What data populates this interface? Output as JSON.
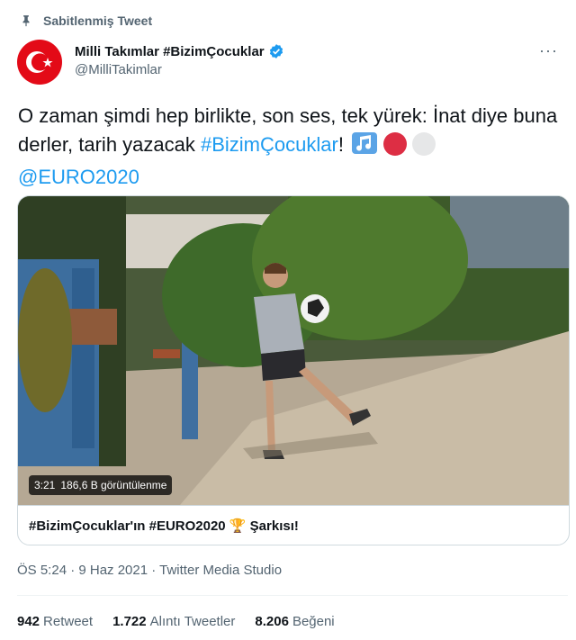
{
  "pinned_label": "Sabitlenmiş Tweet",
  "author": {
    "name": "Milli Takımlar #BizimÇocuklar",
    "handle": "@MilliTakimlar"
  },
  "tweet": {
    "text_part1": "O zaman şimdi hep birlikte, son ses, tek yürek: İnat diye buna derler, tarih yazacak ",
    "hashtag": "#BizimÇocuklar",
    "exclamation": "!",
    "mention": "@EURO2020"
  },
  "video": {
    "duration": "3:21",
    "views": "186,6 B görüntülenme",
    "card_title": "#BizimÇocuklar'ın #EURO2020 🏆 Şarkısı!"
  },
  "meta": "ÖS 5:24 · 9 Haz 2021 · Twitter Media Studio",
  "stats": [
    {
      "value": "942",
      "label": "Retweet"
    },
    {
      "value": "1.722",
      "label": "Alıntı Tweetler"
    },
    {
      "value": "8.206",
      "label": "Beğeni"
    }
  ],
  "colors": {
    "accent": "#1d9bf0",
    "avatar_red": "#e30a17",
    "secondary_text": "#536471"
  },
  "icons": [
    "pin-icon",
    "verified-icon",
    "more-icon",
    "music-note-icon",
    "red-circle-icon",
    "white-circle-icon"
  ]
}
